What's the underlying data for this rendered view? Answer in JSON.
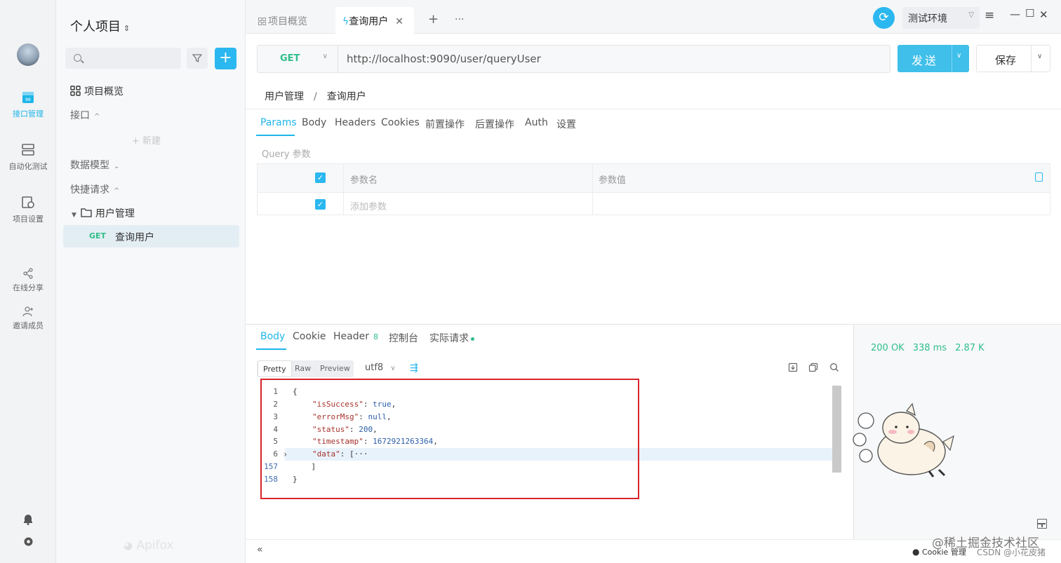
{
  "rail": {
    "items": [
      {
        "label": "接口管理",
        "icon": "api-icon",
        "active": true
      },
      {
        "label": "自动化测试",
        "icon": "automation-icon"
      },
      {
        "label": "项目设置",
        "icon": "project-settings-icon"
      },
      {
        "label": "在线分享",
        "icon": "share-icon"
      },
      {
        "label": "邀请成员",
        "icon": "invite-member-icon"
      }
    ]
  },
  "sidebar": {
    "project_title": "个人项目",
    "overview": "项目概览",
    "api_section": "接口",
    "new_item": "+ 新建",
    "data_models": "数据模型",
    "quick_requests": "快捷请求",
    "folder": "用户管理",
    "selected_method": "GET",
    "selected_name": "查询用户",
    "brand": "Apifox"
  },
  "tabs": {
    "overview": "项目概览",
    "active": "查询用户",
    "add": "+",
    "more": "···"
  },
  "env": {
    "name": "测试环境"
  },
  "request": {
    "method": "GET",
    "url": "http://localhost:9090/user/queryUser",
    "send_label": "发送",
    "save_label": "保存"
  },
  "breadcrumb": {
    "parent": "用户管理",
    "sep": "/",
    "current": "查询用户"
  },
  "req_tabs": [
    "Params",
    "Body",
    "Headers",
    "Cookies",
    "前置操作",
    "后置操作",
    "Auth",
    "设置"
  ],
  "params": {
    "section_label": "Query 参数",
    "col_name": "参数名",
    "col_value": "参数值",
    "add_placeholder": "添加参数"
  },
  "resp_tabs": {
    "body": "Body",
    "cookie": "Cookie",
    "header": "Header",
    "header_count": "8",
    "console": "控制台",
    "actual": "实际请求"
  },
  "resp_status": {
    "code": "200 OK",
    "time": "338 ms",
    "size": "2.87 K"
  },
  "format": {
    "pretty": "Pretty",
    "raw": "Raw",
    "preview": "Preview",
    "encoding": "utf8"
  },
  "code_lines": [
    {
      "n": "1",
      "text": "{"
    },
    {
      "n": "2",
      "key": "\"isSuccess\"",
      "val": "true",
      "tail": ","
    },
    {
      "n": "3",
      "key": "\"errorMsg\"",
      "val": "null",
      "tail": ","
    },
    {
      "n": "4",
      "key": "\"status\"",
      "val": "200",
      "tail": ","
    },
    {
      "n": "5",
      "key": "\"timestamp\"",
      "val": "1672921263364",
      "tail": ","
    },
    {
      "n": "6",
      "key": "\"data\"",
      "val": "[···",
      "tail": ""
    },
    {
      "n": "157",
      "text": "    ]"
    },
    {
      "n": "158",
      "text": "}"
    }
  ],
  "footer": {
    "collapse": "«",
    "cookie_manager": "Cookie 管理",
    "juejin": "@稀土掘金技术社区",
    "csdn": "CSDN @小花皮猪"
  },
  "colors": {
    "accent": "#2bb7ef",
    "get": "#2fbf8a",
    "highlight_box": "#d9232a"
  }
}
